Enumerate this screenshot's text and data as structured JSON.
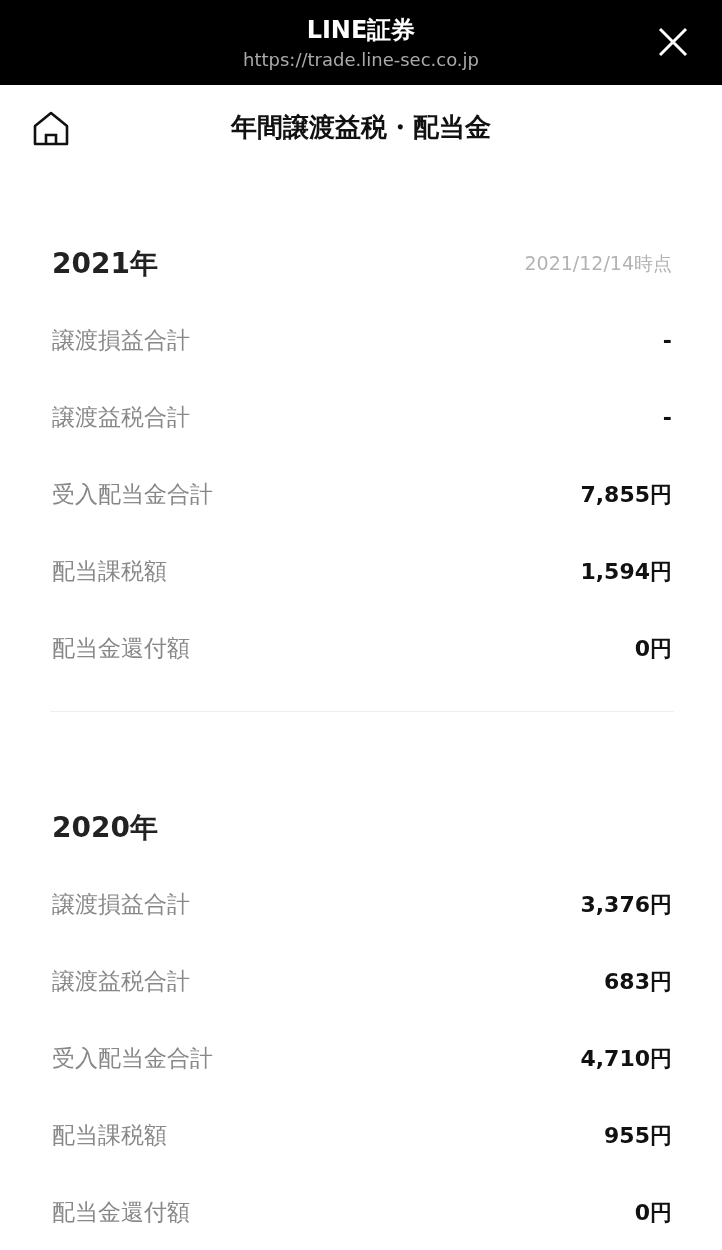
{
  "browser_bar": {
    "title": "LINE証券",
    "url": "https://trade.line-sec.co.jp"
  },
  "page_header": {
    "title": "年間譲渡益税・配当金"
  },
  "sections": [
    {
      "year": "2021年",
      "as_of": "2021/12/14時点",
      "rows": [
        {
          "label": "譲渡損益合計",
          "value": "-"
        },
        {
          "label": "譲渡益税合計",
          "value": "-"
        },
        {
          "label": "受入配当金合計",
          "value": "7,855円"
        },
        {
          "label": "配当課税額",
          "value": "1,594円"
        },
        {
          "label": "配当金還付額",
          "value": "0円"
        }
      ]
    },
    {
      "year": "2020年",
      "rows": [
        {
          "label": "譲渡損益合計",
          "value": "3,376円"
        },
        {
          "label": "譲渡益税合計",
          "value": "683円"
        },
        {
          "label": "受入配当金合計",
          "value": "4,710円"
        },
        {
          "label": "配当課税額",
          "value": "955円"
        },
        {
          "label": "配当金還付額",
          "value": "0円"
        }
      ]
    }
  ]
}
